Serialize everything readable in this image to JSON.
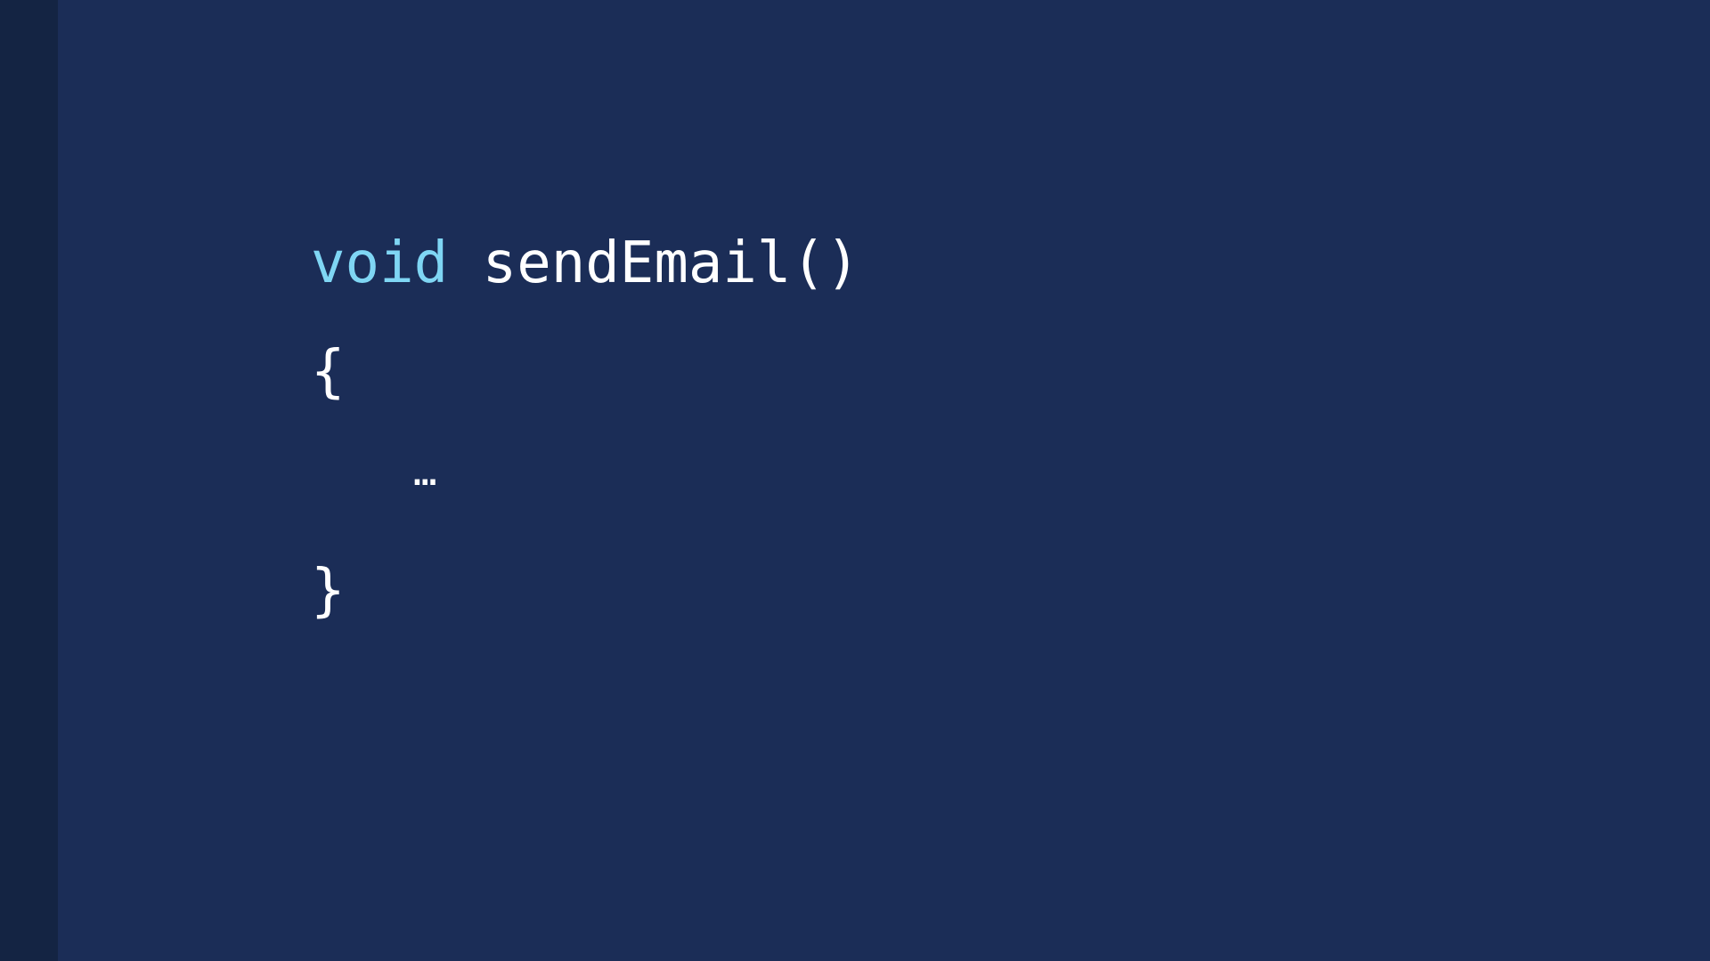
{
  "colors": {
    "background": "#1b2d57",
    "left_strip": "#142443",
    "keyword": "#7fd6f4",
    "text": "#ffffff"
  },
  "code": {
    "line1_keyword": "void",
    "line1_rest": " sendEmail()",
    "line2": "{",
    "line3": "…",
    "line4": "}"
  }
}
